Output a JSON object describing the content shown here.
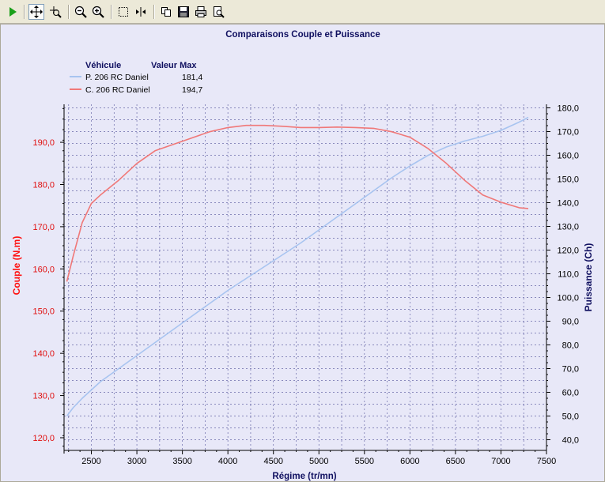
{
  "toolbar": {
    "items": [
      {
        "name": "play-button",
        "icon": "play-icon"
      },
      {
        "name": "pan-button",
        "icon": "move-icon"
      },
      {
        "name": "zoom-region-button",
        "icon": "zoom-region-icon"
      },
      {
        "name": "zoom-out-button",
        "icon": "zoom-out-icon"
      },
      {
        "name": "zoom-in-button",
        "icon": "zoom-in-icon"
      },
      {
        "name": "select-button",
        "icon": "select-rect-icon"
      },
      {
        "name": "cursor-button",
        "icon": "cursor-icon"
      },
      {
        "name": "copy-button",
        "icon": "copy-icon"
      },
      {
        "name": "save-button",
        "icon": "floppy-icon"
      },
      {
        "name": "print-button",
        "icon": "printer-icon"
      },
      {
        "name": "print-preview-button",
        "icon": "print-preview-icon"
      }
    ]
  },
  "chart_data": {
    "type": "line",
    "title": "Comparaisons Couple et Puissance",
    "xlabel": "Régime (tr/mn)",
    "ylabel_left": "Couple (N.m)",
    "ylabel_right": "Puissance (Ch)",
    "xlim": [
      2200,
      7500
    ],
    "ylim_left": [
      117,
      199
    ],
    "ylim_right": [
      35.5,
      181.5
    ],
    "x_ticks": [
      2500,
      3000,
      3500,
      4000,
      4500,
      5000,
      5500,
      6000,
      6500,
      7000,
      7500
    ],
    "y_left_ticks": [
      "120,0",
      "130,0",
      "140,0",
      "150,0",
      "160,0",
      "170,0",
      "180,0",
      "190,0"
    ],
    "y_left_tick_values": [
      120,
      130,
      140,
      150,
      160,
      170,
      180,
      190
    ],
    "y_right_ticks": [
      "40,0",
      "50,0",
      "60,0",
      "70,0",
      "80,0",
      "90,0",
      "100,0",
      "110,0",
      "120,0",
      "130,0",
      "140,0",
      "150,0",
      "160,0",
      "170,0",
      "180,0"
    ],
    "y_right_tick_values": [
      40,
      50,
      60,
      70,
      80,
      90,
      100,
      110,
      120,
      130,
      140,
      150,
      160,
      170,
      180
    ],
    "grid": true,
    "legend": {
      "position": "top-left",
      "header_name": "Véhicule",
      "header_value": "Valeur Max",
      "entries": [
        {
          "name": "P. 206 RC Daniel",
          "value": "181,4",
          "color": "#a8c4f0"
        },
        {
          "name": "C. 206 RC Daniel",
          "value": "194,7",
          "color": "#f07878"
        }
      ]
    },
    "series": [
      {
        "name": "P. 206 RC Daniel",
        "axis": "right",
        "color": "#a8c4f0",
        "x": [
          2230,
          2300,
          2400,
          2500,
          2600,
          2800,
          3000,
          3200,
          3400,
          3600,
          3800,
          4000,
          4200,
          4400,
          4600,
          4800,
          5000,
          5200,
          5400,
          5600,
          5800,
          6000,
          6200,
          6400,
          6600,
          6800,
          7000,
          7200,
          7300
        ],
        "y": [
          50,
          53.5,
          57.5,
          61,
          64.5,
          70,
          75.5,
          81,
          86.5,
          92,
          97.5,
          103,
          108,
          113,
          118,
          123,
          128.5,
          134,
          139.5,
          145,
          150.5,
          155.5,
          160,
          163.5,
          166,
          168,
          170.5,
          174,
          176
        ]
      },
      {
        "name": "C. 206 RC Daniel",
        "axis": "left",
        "color": "#f07878",
        "x": [
          2230,
          2300,
          2400,
          2500,
          2600,
          2800,
          3000,
          3200,
          3400,
          3600,
          3800,
          4000,
          4200,
          4400,
          4600,
          4800,
          5000,
          5200,
          5400,
          5600,
          5800,
          6000,
          6200,
          6400,
          6600,
          6800,
          7000,
          7200,
          7300
        ],
        "y": [
          157,
          163,
          171,
          175.5,
          177.5,
          181,
          185,
          188,
          189.5,
          191,
          192.5,
          193.5,
          194,
          194,
          193.8,
          193.5,
          193.5,
          193.6,
          193.5,
          193.3,
          192.5,
          191.2,
          188.5,
          185,
          181,
          177.5,
          175.8,
          174.5,
          174.3
        ]
      }
    ]
  }
}
